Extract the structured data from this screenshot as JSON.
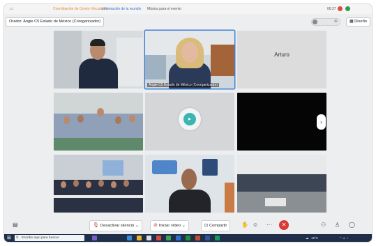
{
  "app": {
    "top_tabs": [
      "Coordinación de Centro Vinculación",
      "Información de la reunión",
      "Música para el evento"
    ],
    "clock": "06:27"
  },
  "meeting": {
    "organizer_label": "Orador: Angie C5 Estado de México (Coorganizador)",
    "layout_button": "Diseño"
  },
  "participants": [
    {
      "name": ""
    },
    {
      "name": "Angie C5 Estado de México (Coorganizador)"
    },
    {
      "name": "Arturo"
    },
    {
      "name": ""
    },
    {
      "name": ""
    },
    {
      "name": ""
    },
    {
      "name": ""
    },
    {
      "name": ""
    },
    {
      "name": ""
    }
  ],
  "toolbar": {
    "mute_label": "Desactivar silencio",
    "video_label": "Iniciar vídeo",
    "share_label": "Compartir",
    "more_label": "···"
  },
  "taskbar": {
    "search_placeholder": "Escribe aquí para buscar",
    "temperature": "19°C"
  },
  "colors": {
    "accent_blue": "#3f82d6",
    "end_call_red": "#d93a35",
    "toolbar_red": "#c2342f",
    "taskbar": "#1f2f4a"
  },
  "icons": [
    "chevron-right-icon",
    "mic-icon",
    "video-icon",
    "share-icon",
    "hand-icon",
    "emoji-icon",
    "end-call-icon",
    "participants-icon",
    "chat-icon",
    "search-icon",
    "windows-icon"
  ]
}
